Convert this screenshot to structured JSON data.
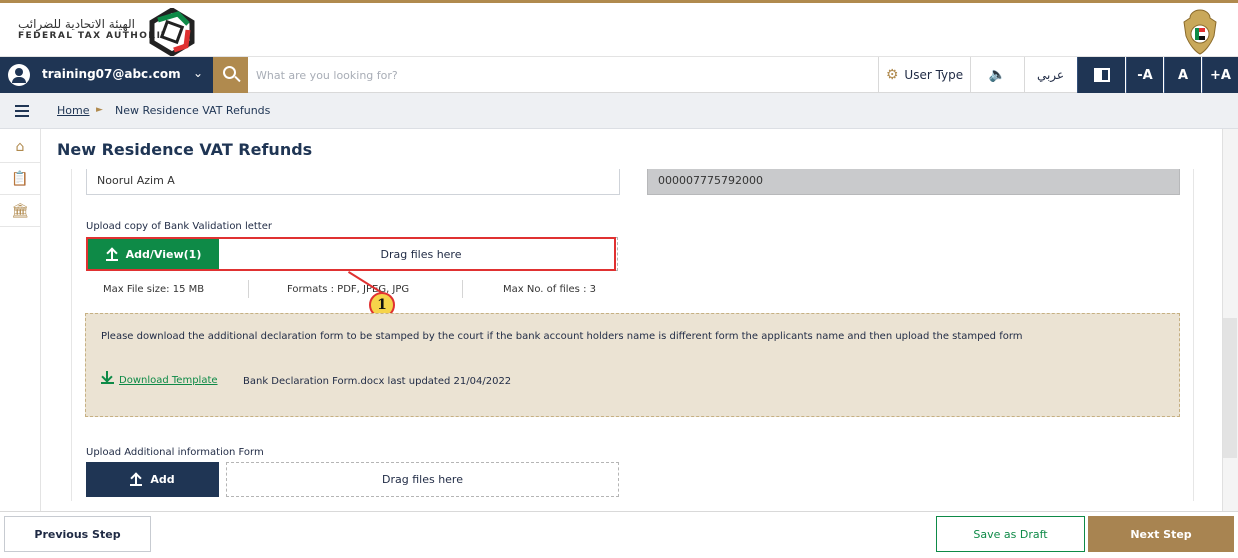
{
  "brand": {
    "arabic_name": "الهيئة الاتحادية للضرائب",
    "english_name": "FEDERAL TAX AUTHORITY",
    "logo_icon": "fta-logo-icon",
    "emblem_icon": "uae-emblem-icon",
    "accent_color": "#b08a4e",
    "navy_color": "#1f3554",
    "green_color": "#0e8a47"
  },
  "toolbar": {
    "user_email": "training07@abc.com",
    "search_placeholder": "What are you looking for?",
    "user_type_label": "User Type",
    "arabic_label": "عربي",
    "font_decrease": "-A",
    "font_normal": "A",
    "font_increase": "+A"
  },
  "breadcrumb": {
    "home": "Home",
    "separator": "►",
    "current": "New Residence VAT Refunds"
  },
  "page": {
    "title": "New Residence VAT Refunds"
  },
  "form": {
    "account_holder_value": "Noorul Azim A",
    "account_number_value": "000007775792000",
    "bank_letter_label": "Upload copy of Bank Validation letter",
    "add_view_label": "Add/View(1)",
    "drag_label": "Drag files here",
    "max_size": "Max File size: 15 MB",
    "formats": "Formats : PDF, JPEG, JPG",
    "max_files": "Max No. of files : 3",
    "callout_number": "1",
    "notice_text": "Please download the additional declaration form to be stamped by the court if the bank account holders name is different form the applicants name and then upload the stamped form",
    "download_label": "Download Template",
    "download_info": "Bank Declaration Form.docx last updated 21/04/2022",
    "additional_label": "Upload Additional information Form",
    "add_label": "Add",
    "drag_label_2": "Drag files here"
  },
  "footer": {
    "previous": "Previous Step",
    "save_draft": "Save as Draft",
    "next": "Next Step"
  }
}
